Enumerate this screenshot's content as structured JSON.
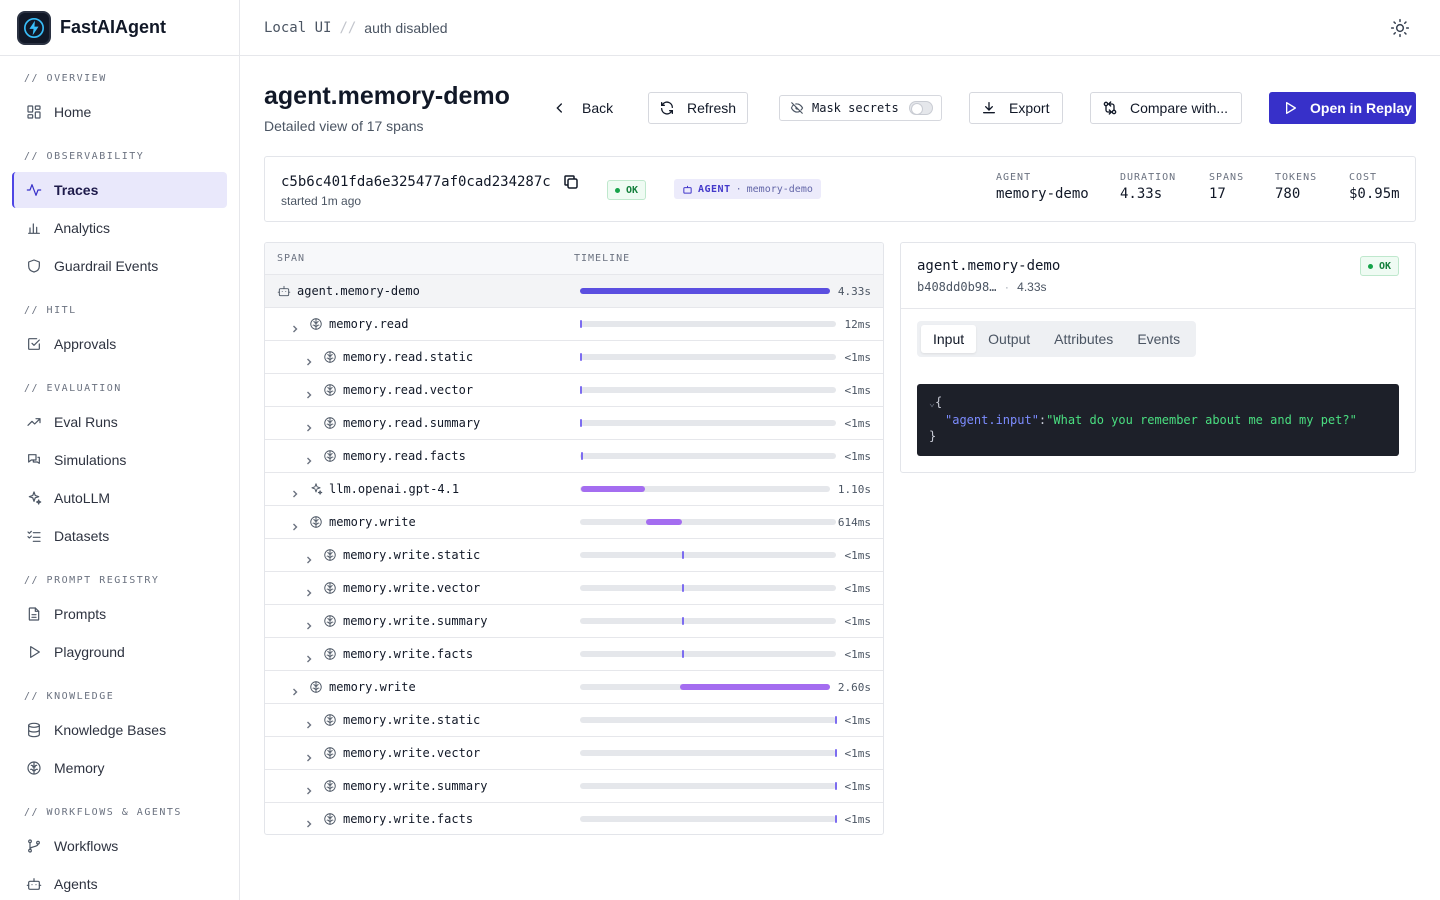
{
  "app": {
    "name": "FastAIAgent"
  },
  "sidebar": {
    "sections": [
      {
        "label": "// OVERVIEW",
        "items": [
          {
            "label": "Home",
            "icon": "dashboard-grid-icon"
          }
        ]
      },
      {
        "label": "// OBSERVABILITY",
        "items": [
          {
            "label": "Traces",
            "icon": "activity-icon",
            "active": true
          },
          {
            "label": "Analytics",
            "icon": "bar-chart-icon"
          },
          {
            "label": "Guardrail Events",
            "icon": "shield-icon"
          }
        ]
      },
      {
        "label": "// HITL",
        "items": [
          {
            "label": "Approvals",
            "icon": "check-square-icon"
          }
        ]
      },
      {
        "label": "// EVALUATION",
        "items": [
          {
            "label": "Eval Runs",
            "icon": "trending-up-icon"
          },
          {
            "label": "Simulations",
            "icon": "chat-bubbles-icon"
          },
          {
            "label": "AutoLLM",
            "icon": "sparkles-icon"
          },
          {
            "label": "Datasets",
            "icon": "list-checks-icon"
          }
        ]
      },
      {
        "label": "// PROMPT REGISTRY",
        "items": [
          {
            "label": "Prompts",
            "icon": "document-icon"
          },
          {
            "label": "Playground",
            "icon": "play-icon"
          }
        ]
      },
      {
        "label": "// KNOWLEDGE",
        "items": [
          {
            "label": "Knowledge Bases",
            "icon": "database-icon"
          },
          {
            "label": "Memory",
            "icon": "brain-icon"
          }
        ]
      },
      {
        "label": "// WORKFLOWS & AGENTS",
        "items": [
          {
            "label": "Workflows",
            "icon": "git-branch-icon"
          },
          {
            "label": "Agents",
            "icon": "bot-icon"
          }
        ]
      }
    ]
  },
  "topbar": {
    "env": "Local UI",
    "separator": "//",
    "auth": "auth disabled"
  },
  "header": {
    "title": "agent.memory-demo",
    "subtitle": "Detailed view of 17 spans",
    "back": "Back",
    "refresh": "Refresh",
    "mask_secrets": "Mask secrets",
    "export": "Export",
    "compare": "Compare with...",
    "open_replay": "Open in Replay"
  },
  "trace": {
    "id": "c5b6c401fda6e325477af0cad234287c",
    "started": "started 1m ago",
    "status": "OK",
    "badge_type": "AGENT",
    "badge_sep": "·",
    "badge_name": "memory-demo",
    "meta": [
      {
        "label": "AGENT",
        "value": "memory-demo"
      },
      {
        "label": "DURATION",
        "value": "4.33s"
      },
      {
        "label": "SPANS",
        "value": "17"
      },
      {
        "label": "TOKENS",
        "value": "780"
      },
      {
        "label": "COST",
        "value": "$0.95m"
      }
    ]
  },
  "span_table": {
    "col_span": "SPAN",
    "col_timeline": "TIMELINE",
    "rows": [
      {
        "name": "agent.memory-demo",
        "depth": 0,
        "icon": "bot-icon",
        "duration": "4.33s",
        "start": 0,
        "width": 1,
        "kind": "root"
      },
      {
        "name": "memory.read",
        "depth": 1,
        "icon": "brain-icon",
        "duration": "12ms",
        "start": 0,
        "width": 0.003
      },
      {
        "name": "memory.read.static",
        "depth": 2,
        "icon": "brain-icon",
        "duration": "<1ms",
        "start": 0,
        "width": 0.002
      },
      {
        "name": "memory.read.vector",
        "depth": 2,
        "icon": "brain-icon",
        "duration": "<1ms",
        "start": 0,
        "width": 0.002
      },
      {
        "name": "memory.read.summary",
        "depth": 2,
        "icon": "brain-icon",
        "duration": "<1ms",
        "start": 0,
        "width": 0.002
      },
      {
        "name": "memory.read.facts",
        "depth": 2,
        "icon": "brain-icon",
        "duration": "<1ms",
        "start": 0.002,
        "width": 0.002
      },
      {
        "name": "llm.openai.gpt-4.1",
        "depth": 1,
        "icon": "sparkles-icon",
        "duration": "1.10s",
        "start": 0.003,
        "width": 0.254
      },
      {
        "name": "memory.write",
        "depth": 1,
        "icon": "brain-icon",
        "duration": "614ms",
        "start": 0.256,
        "width": 0.142
      },
      {
        "name": "memory.write.static",
        "depth": 2,
        "icon": "brain-icon",
        "duration": "<1ms",
        "start": 0.398,
        "width": 0.002
      },
      {
        "name": "memory.write.vector",
        "depth": 2,
        "icon": "brain-icon",
        "duration": "<1ms",
        "start": 0.398,
        "width": 0.002
      },
      {
        "name": "memory.write.summary",
        "depth": 2,
        "icon": "brain-icon",
        "duration": "<1ms",
        "start": 0.398,
        "width": 0.002
      },
      {
        "name": "memory.write.facts",
        "depth": 2,
        "icon": "brain-icon",
        "duration": "<1ms",
        "start": 0.398,
        "width": 0.002
      },
      {
        "name": "memory.write",
        "depth": 1,
        "icon": "brain-icon",
        "duration": "2.60s",
        "start": 0.4,
        "width": 0.6
      },
      {
        "name": "memory.write.static",
        "depth": 2,
        "icon": "brain-icon",
        "duration": "<1ms",
        "start": 0.998,
        "width": 0.002
      },
      {
        "name": "memory.write.vector",
        "depth": 2,
        "icon": "brain-icon",
        "duration": "<1ms",
        "start": 0.998,
        "width": 0.002
      },
      {
        "name": "memory.write.summary",
        "depth": 2,
        "icon": "brain-icon",
        "duration": "<1ms",
        "start": 0.998,
        "width": 0.002
      },
      {
        "name": "memory.write.facts",
        "depth": 2,
        "icon": "brain-icon",
        "duration": "<1ms",
        "start": 0.998,
        "width": 0.002
      }
    ]
  },
  "detail": {
    "title": "agent.memory-demo",
    "span_id": "b408dd0b98…",
    "dot": "·",
    "duration": "4.33s",
    "status": "OK",
    "tabs": [
      "Input",
      "Output",
      "Attributes",
      "Events"
    ],
    "active_tab": "Input",
    "code": {
      "open": "{",
      "key": "\"agent.input\"",
      "colon": ":",
      "value": "\"What do you remember about me and my pet?\"",
      "close": "}"
    }
  },
  "colors": {
    "accent": "#3730c9",
    "root_bar": "#5b4fe0",
    "span_bar": "#a46df0",
    "ok": "#16a34a",
    "active_nav_bg": "#e9e8fb"
  }
}
